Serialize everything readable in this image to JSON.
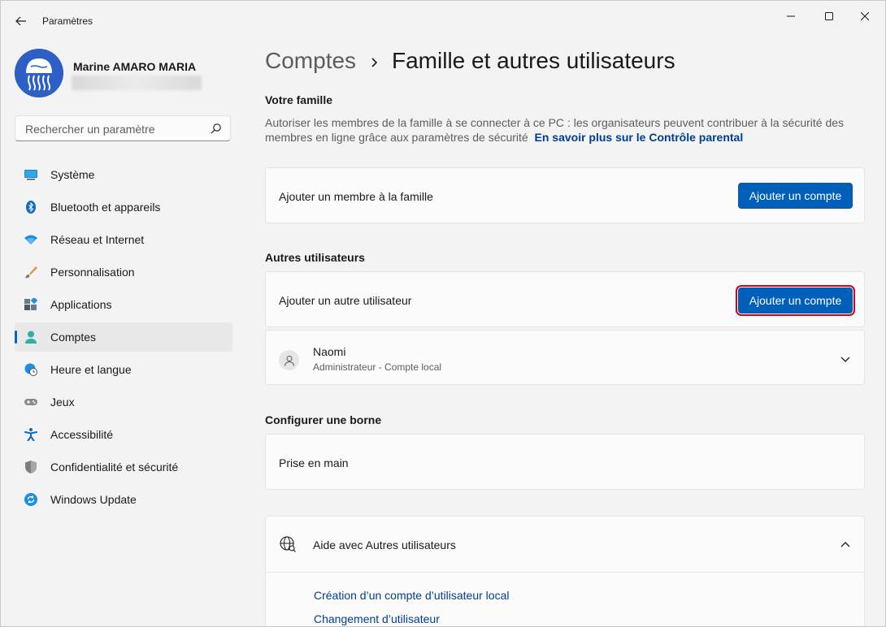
{
  "window": {
    "title": "Paramètres",
    "controls": [
      "minimize-icon",
      "maximize-icon",
      "close-icon"
    ]
  },
  "profile": {
    "name": "Marine AMARO MARIA",
    "email_blurred": true
  },
  "search": {
    "placeholder": "Rechercher un paramètre",
    "value": ""
  },
  "sidebar": {
    "items": [
      {
        "label": "Système",
        "icon": "display-icon",
        "active": false
      },
      {
        "label": "Bluetooth et appareils",
        "icon": "bluetooth-icon",
        "active": false
      },
      {
        "label": "Réseau et Internet",
        "icon": "wifi-icon",
        "active": false
      },
      {
        "label": "Personnalisation",
        "icon": "brush-icon",
        "active": false
      },
      {
        "label": "Applications",
        "icon": "apps-icon",
        "active": false
      },
      {
        "label": "Comptes",
        "icon": "person-icon",
        "active": true
      },
      {
        "label": "Heure et langue",
        "icon": "globe-clock-icon",
        "active": false
      },
      {
        "label": "Jeux",
        "icon": "gamepad-icon",
        "active": false
      },
      {
        "label": "Accessibilité",
        "icon": "accessibility-icon",
        "active": false
      },
      {
        "label": "Confidentialité et sécurité",
        "icon": "shield-icon",
        "active": false
      },
      {
        "label": "Windows Update",
        "icon": "refresh-icon",
        "active": false
      }
    ]
  },
  "breadcrumb": {
    "parent": "Comptes",
    "current": "Famille et autres utilisateurs"
  },
  "family": {
    "title": "Votre famille",
    "description": "Autoriser les membres de la famille à se connecter à ce PC : les organisateurs peuvent contribuer à la sécurité des membres en ligne grâce aux paramètres de sécurité",
    "link": "En savoir plus sur le Contrôle parental",
    "card_label": "Ajouter un membre à la famille",
    "button": "Ajouter un compte"
  },
  "others": {
    "title": "Autres utilisateurs",
    "card_label": "Ajouter un autre utilisateur",
    "button": "Ajouter un compte",
    "users": [
      {
        "name": "Naomi",
        "subtitle": "Administrateur - Compte local"
      }
    ]
  },
  "kiosk": {
    "title": "Configurer une borne",
    "card_label": "Prise en main"
  },
  "help": {
    "title": "Aide avec Autres utilisateurs",
    "links": [
      "Création d’un compte d’utilisateur local",
      "Changement d’utilisateur"
    ]
  },
  "colors": {
    "accent": "#005fb8",
    "link": "#003e92",
    "highlight_border": "#d0021b"
  }
}
